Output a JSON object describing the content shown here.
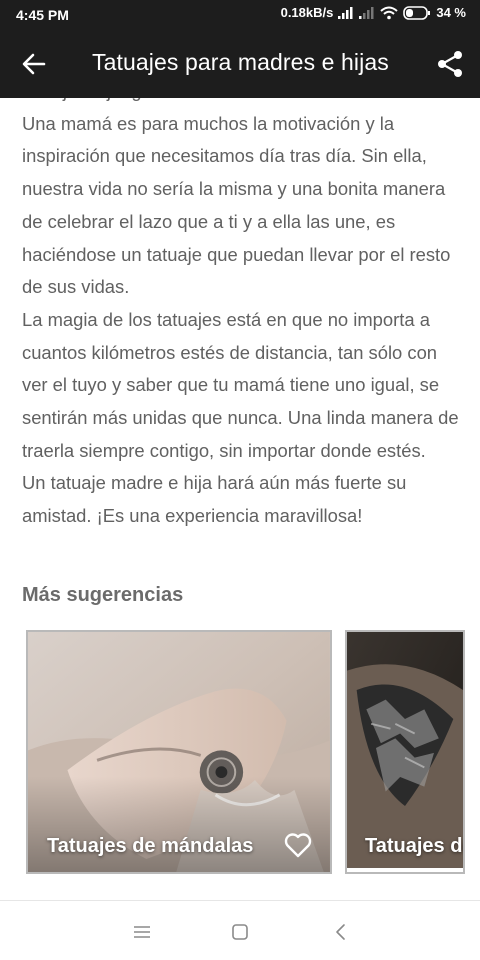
{
  "status_bar": {
    "time": "4:45 PM",
    "net_speed": "0.18kB/s",
    "battery_percent": "34 %",
    "icons": [
      "signal-icon",
      "signal-weak-icon",
      "wifi-icon",
      "battery-icon"
    ]
  },
  "toolbar": {
    "title": "Tatuajes para madres e hijas",
    "back_icon": "arrow-left-icon",
    "share_icon": "share-icon",
    "background": "#1d1d1d"
  },
  "article": {
    "cut_line": "tatuajes a juego.",
    "paragraphs": [
      "Una mamá es para muchos la motivación y la inspiración que necesitamos día tras día. Sin ella, nuestra vida no sería la misma y una bonita manera de celebrar el lazo que a ti y a ella las une, es haciéndose un tatuaje que puedan llevar por el resto de sus vidas.",
      "La magia de los tatuajes está en que no importa a cuantos kilómetros estés de distancia, tan sólo con ver el tuyo y saber que tu mamá tiene uno igual, se sentirán más unidas que nunca. Una linda manera de traerla siempre contigo, sin importar donde estés.",
      "Un tatuaje madre e hija hará aún más fuerte su amistad. ¡Es una experiencia maravillosa!"
    ]
  },
  "suggestions": {
    "heading": "Más sugerencias",
    "cards": [
      {
        "title": "Tatuajes de mándalas",
        "favorite_icon": "heart-outline-icon"
      },
      {
        "title": "Tatuajes de"
      }
    ]
  },
  "nav_bar": {
    "icons": [
      "menu-icon",
      "home-square-icon",
      "back-chevron-icon"
    ]
  }
}
